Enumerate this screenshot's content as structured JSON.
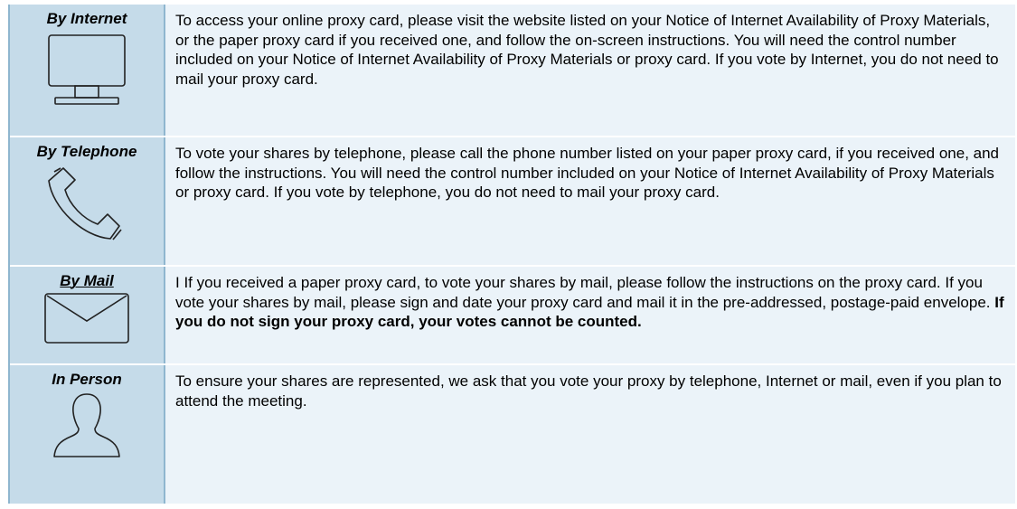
{
  "rows": [
    {
      "method": "By Internet",
      "icon": "computer-monitor-icon",
      "description": "To access your online proxy card, please visit the website listed on your Notice of Internet Availability of Proxy Materials, or the paper proxy card if you received one, and follow the on-screen instructions. You will need the control number included on your Notice of Internet Availability of Proxy Materials or proxy card. If you vote by Internet, you do not need to mail your proxy card."
    },
    {
      "method": "By Telephone",
      "icon": "telephone-handset-icon",
      "description": "To vote your shares by telephone, please call the phone number listed on your paper proxy card, if you received one, and follow the instructions. You will need the control number included on your Notice of Internet Availability of Proxy Materials or proxy card. If you vote by telephone, you do not need to mail your proxy card."
    },
    {
      "method": "By Mail",
      "icon": "envelope-icon",
      "description": "I If you received a paper proxy card, to vote your shares by mail, please follow the instructions on the proxy card. If you vote your shares by mail, please sign and date your proxy card and mail it in the pre-addressed, postage-paid envelope. ",
      "description_bold": "If you do not sign your proxy card, your votes cannot be counted."
    },
    {
      "method": "In Person",
      "icon": "person-silhouette-icon",
      "description": "To ensure your shares are represented, we ask that you vote your proxy by telephone, Internet or mail, even if you plan to attend the meeting."
    }
  ],
  "colors": {
    "method_cell_bg": "#c5dbe9",
    "description_cell_bg": "#ebf3f9",
    "border": "#8fb6cf"
  }
}
